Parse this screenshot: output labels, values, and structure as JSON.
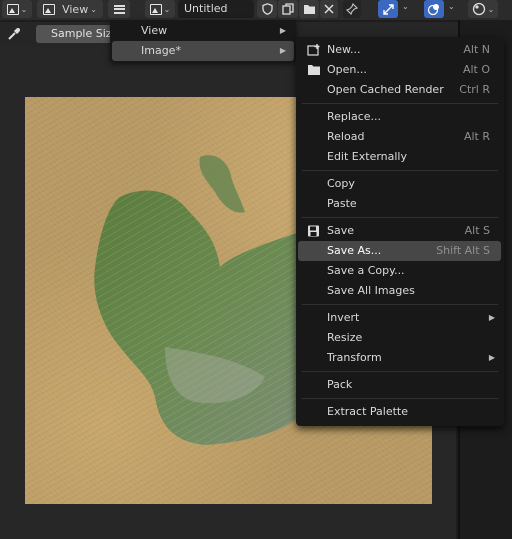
{
  "header": {
    "view_label": "View",
    "image_name": "Untitled",
    "active_color": "#3b69c1"
  },
  "toolbar": {
    "sample_size_label": "Sample Size"
  },
  "menu": {
    "view_label": "View",
    "image_label": "Image*"
  },
  "image_menu": {
    "items": [
      {
        "label": "New...",
        "shortcut": "Alt N",
        "icon": "new-image-icon"
      },
      {
        "label": "Open...",
        "shortcut": "Alt O",
        "icon": "folder-icon"
      },
      {
        "label": "Open Cached Render",
        "shortcut": "Ctrl R"
      },
      {
        "label": "Replace...",
        "shortcut": ""
      },
      {
        "label": "Reload",
        "shortcut": "Alt R"
      },
      {
        "label": "Edit Externally",
        "shortcut": ""
      },
      {
        "label": "Copy",
        "shortcut": ""
      },
      {
        "label": "Paste",
        "shortcut": ""
      },
      {
        "label": "Save",
        "shortcut": "Alt S",
        "icon": "save-icon"
      },
      {
        "label": "Save As...",
        "shortcut": "Shift Alt S"
      },
      {
        "label": "Save a Copy...",
        "shortcut": ""
      },
      {
        "label": "Save All Images",
        "shortcut": ""
      },
      {
        "label": "Invert",
        "shortcut": ""
      },
      {
        "label": "Resize",
        "shortcut": ""
      },
      {
        "label": "Transform",
        "shortcut": ""
      },
      {
        "label": "Pack",
        "shortcut": ""
      },
      {
        "label": "Extract Palette",
        "shortcut": ""
      }
    ]
  }
}
